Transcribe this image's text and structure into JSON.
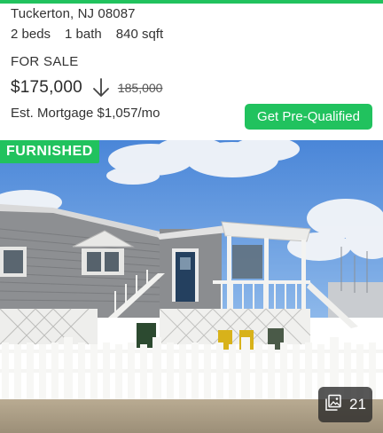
{
  "listing": {
    "address": "Tuckerton, NJ 08087",
    "beds": "2 beds",
    "baths": "1 bath",
    "sqft": "840 sqft",
    "status": "FOR SALE",
    "price": "$175,000",
    "price_change_icon": "arrow-down-icon",
    "old_price": "185,000",
    "mortgage": "Est. Mortgage $1,057/mo",
    "cta_label": "Get Pre-Qualified"
  },
  "photo": {
    "badge": "FURNISHED",
    "photo_count": "21",
    "count_icon": "image-gallery-icon"
  },
  "colors": {
    "accent": "#21c25e",
    "text": "#333333"
  }
}
